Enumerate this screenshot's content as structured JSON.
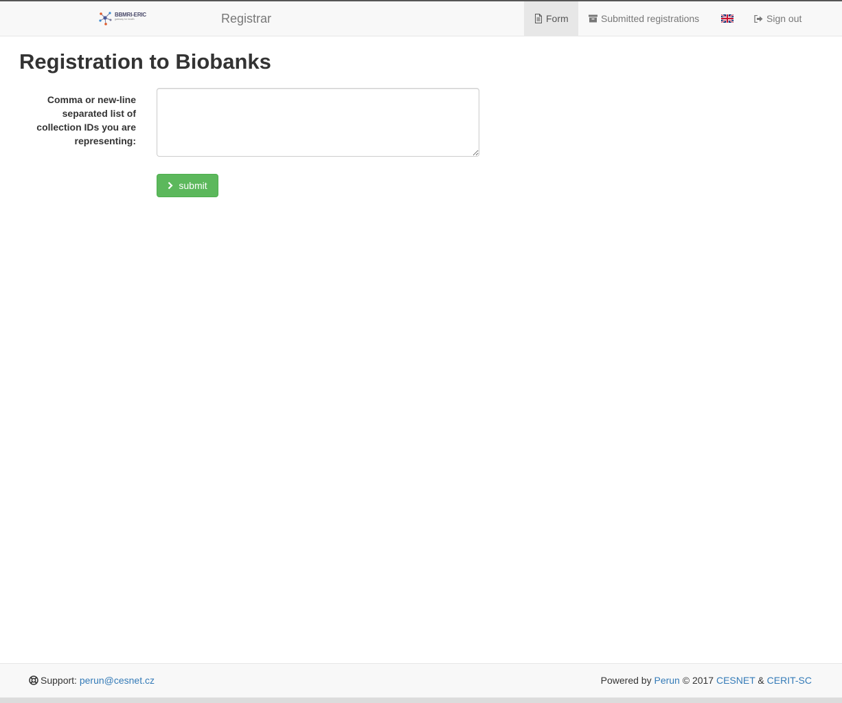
{
  "navbar": {
    "logo_name": "BBMRI-ERIC",
    "logo_tagline": "gateway for health",
    "brand": "Registrar",
    "items": [
      {
        "label": "Form",
        "icon": "file-icon",
        "active": true
      },
      {
        "label": "Submitted registrations",
        "icon": "archive-icon",
        "active": false
      },
      {
        "label": "",
        "icon": "uk-flag-icon",
        "active": false
      },
      {
        "label": "Sign out",
        "icon": "log-out-icon",
        "active": false
      }
    ]
  },
  "main": {
    "title": "Registration to Biobanks",
    "field_label": "Comma or new-line separated list of collection IDs you are representing:",
    "textarea_value": "",
    "submit_label": "submit"
  },
  "footer": {
    "support_label": "Support:",
    "support_email": "perun@cesnet.cz",
    "powered_by": "Powered by",
    "perun": "Perun",
    "copyright": "© 2017",
    "cesnet": "CESNET",
    "amp": "&",
    "cerit": "CERIT-SC"
  },
  "colors": {
    "submit_bg": "#5cb85c",
    "link": "#337ab7",
    "navbar_bg": "#f8f8f8"
  }
}
